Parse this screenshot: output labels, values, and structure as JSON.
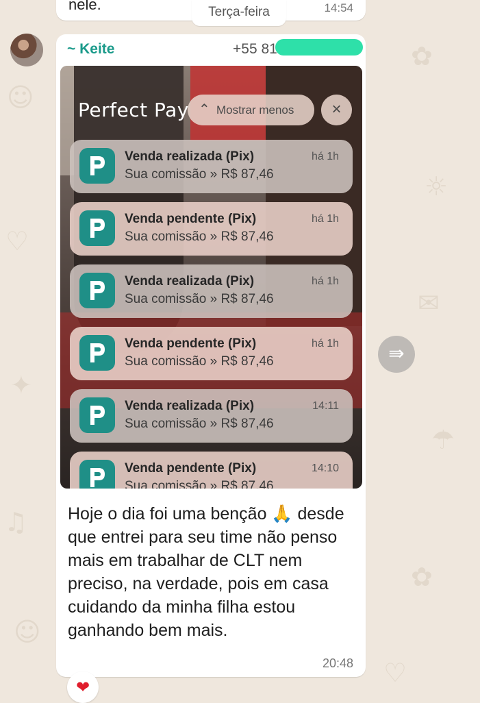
{
  "previous_message": {
    "text": "nele.",
    "time": "14:54"
  },
  "date_separator": "Terça-feira",
  "message": {
    "sender_name": "~ Keite",
    "sender_phone": "+55 81",
    "photo": {
      "app_title": "Perfect Pay",
      "show_less_label": "Mostrar menos",
      "close_icon": "×",
      "notifications": [
        {
          "title": "Venda realizada (Pix)",
          "body": "Sua comissão » R$ 87,46",
          "time": "há 1h"
        },
        {
          "title": "Venda pendente (Pix)",
          "body": "Sua comissão » R$ 87,46",
          "time": "há 1h"
        },
        {
          "title": "Venda realizada (Pix)",
          "body": "Sua comissão » R$ 87,46",
          "time": "há 1h"
        },
        {
          "title": "Venda pendente (Pix)",
          "body": "Sua comissão » R$ 87,46",
          "time": "há 1h"
        },
        {
          "title": "Venda realizada (Pix)",
          "body": "Sua comissão » R$ 87,46",
          "time": "14:11"
        },
        {
          "title": "Venda pendente (Pix)",
          "body": "Sua comissão » R$ 87,46",
          "time": "14:10"
        }
      ]
    },
    "caption": "Hoje o dia foi uma benção 🙏 desde que entrei para seu time não penso mais em trabalhar de CLT nem preciso, na verdade, pois em casa cuidando da minha filha estou ganhando bem mais.",
    "time": "20:48",
    "reaction": "❤"
  },
  "icons": {
    "forward": "forward-icon",
    "reaction": "heart-icon",
    "app": "perfect-pay-logo-icon",
    "chevron": "chevron-up-icon"
  },
  "colors": {
    "sender_name": "#1a9a8a",
    "app_icon": "#1f8f87",
    "phone_mask": "#2ee0a9",
    "background": "#efe7dd"
  }
}
